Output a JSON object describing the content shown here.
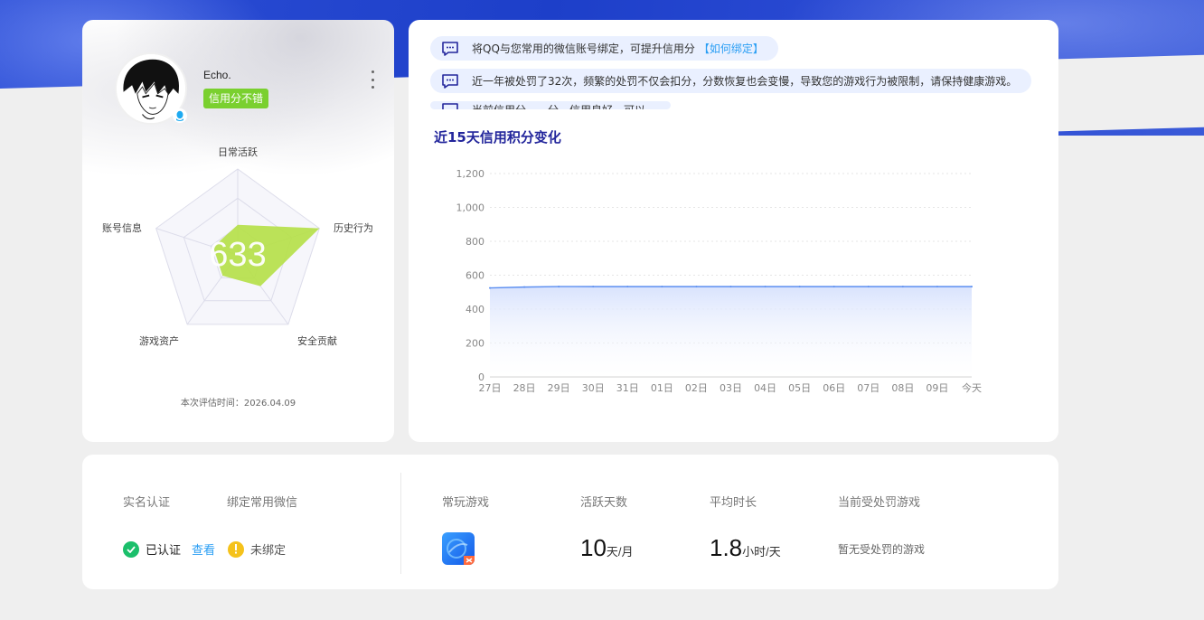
{
  "profile": {
    "nickname": "Echo.",
    "credit_tag": "信用分不错",
    "score": "633",
    "radar_axes": [
      "日常活跃",
      "历史行为",
      "安全贡献",
      "游戏资产",
      "账号信息"
    ],
    "radar_values": [
      0.35,
      1.0,
      0.45,
      0.3,
      0.3
    ],
    "eval_time": "本次评估时间：2026.04.09"
  },
  "notices": [
    {
      "text": "将QQ与您常用的微信账号绑定，可提升信用分",
      "link": "【如何绑定】"
    },
    {
      "text": "近一年被处罚了32次，频繁的处罚不仅会扣分，分数恢复也会变慢，导致您的游戏行为被限制，请保持健康游戏。",
      "link": ""
    },
    {
      "text": "当前信用分……分，信用良好，可以…",
      "link": ""
    }
  ],
  "chart_data": {
    "type": "area",
    "title": "近15天信用积分变化",
    "xlabel": "",
    "ylabel": "",
    "x": [
      "27日",
      "28日",
      "29日",
      "30日",
      "31日",
      "01日",
      "02日",
      "03日",
      "04日",
      "05日",
      "06日",
      "07日",
      "08日",
      "09日",
      "今天"
    ],
    "series": [
      {
        "values": [
          525,
          530,
          533,
          533,
          533,
          533,
          533,
          533,
          533,
          533,
          533,
          533,
          533,
          533,
          533
        ]
      }
    ],
    "ylim": [
      0,
      1200
    ],
    "yticks": [
      "0",
      "200",
      "400",
      "600",
      "800",
      "1,000",
      "1,200"
    ],
    "ytick_values": [
      0,
      200,
      400,
      600,
      800,
      1000,
      1200
    ],
    "grid": true,
    "colors": {
      "line": "#5b8ef0",
      "fill_top": "#dde6fd"
    }
  },
  "bottom": {
    "real_name_label": "实名认证",
    "wechat_label": "绑定常用微信",
    "verified_text": "已认证",
    "view_link": "查看",
    "unbound_text": "未绑定",
    "common_games_label": "常玩游戏",
    "active_days_label": "活跃天数",
    "active_days_value": "10",
    "active_days_unit": "天/月",
    "avg_duration_label": "平均时长",
    "avg_duration_value": "1.8",
    "avg_duration_unit": "小时/天",
    "penalty_label": "当前受处罚游戏",
    "penalty_text": "暂无受处罚的游戏"
  },
  "colors": {
    "brand_blue": "#1d3fc9",
    "success_green": "#1bbf6b",
    "warn_yellow": "#f5c21b",
    "tag_green": "#7ad02f",
    "link_blue": "#2a9ef4"
  }
}
